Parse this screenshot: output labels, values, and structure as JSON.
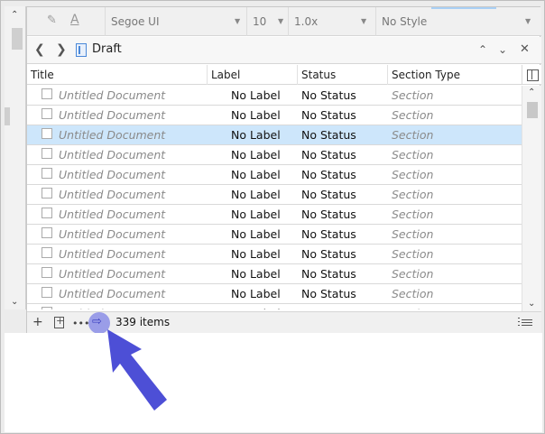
{
  "format_bar": {
    "font_family": "Segoe UI",
    "font_size": "10",
    "line_spacing": "1.0x",
    "style": "No Style"
  },
  "nav": {
    "back_label": "<",
    "forward_label": ">",
    "title": "Draft",
    "up_label": "^",
    "down_label": "v",
    "close_label": "X"
  },
  "columns": [
    "Title",
    "Label",
    "Status",
    "Section Type"
  ],
  "rows": [
    {
      "title": "Untitled Document",
      "label": "No Label",
      "status": "No Status",
      "section_type": "Section"
    },
    {
      "title": "Untitled Document",
      "label": "No Label",
      "status": "No Status",
      "section_type": "Section"
    },
    {
      "title": "Untitled Document",
      "label": "No Label",
      "status": "No Status",
      "section_type": "Section",
      "selected": true
    },
    {
      "title": "Untitled Document",
      "label": "No Label",
      "status": "No Status",
      "section_type": "Section"
    },
    {
      "title": "Untitled Document",
      "label": "No Label",
      "status": "No Status",
      "section_type": "Section"
    },
    {
      "title": "Untitled Document",
      "label": "No Label",
      "status": "No Status",
      "section_type": "Section"
    },
    {
      "title": "Untitled Document",
      "label": "No Label",
      "status": "No Status",
      "section_type": "Section"
    },
    {
      "title": "Untitled Document",
      "label": "No Label",
      "status": "No Status",
      "section_type": "Section"
    },
    {
      "title": "Untitled Document",
      "label": "No Label",
      "status": "No Status",
      "section_type": "Section"
    },
    {
      "title": "Untitled Document",
      "label": "No Label",
      "status": "No Status",
      "section_type": "Section"
    },
    {
      "title": "Untitled Document",
      "label": "No Label",
      "status": "No Status",
      "section_type": "Section"
    },
    {
      "title": "Untitled Document",
      "label": "No Label",
      "status": "No Status",
      "section_type": "Section"
    }
  ],
  "footer": {
    "add_label": "+",
    "more_label": "•••",
    "export_glyph": "⇨",
    "item_count": "339 items"
  },
  "colors": {
    "selection": "#cde6fb",
    "accent_arrow": "#4d4fd6",
    "export_highlight": "#9a9de8"
  },
  "icons": {
    "format_pen": "pen-icon",
    "font_color": "font-color-icon",
    "doc": "document-icon",
    "list": "list-view-icon"
  }
}
